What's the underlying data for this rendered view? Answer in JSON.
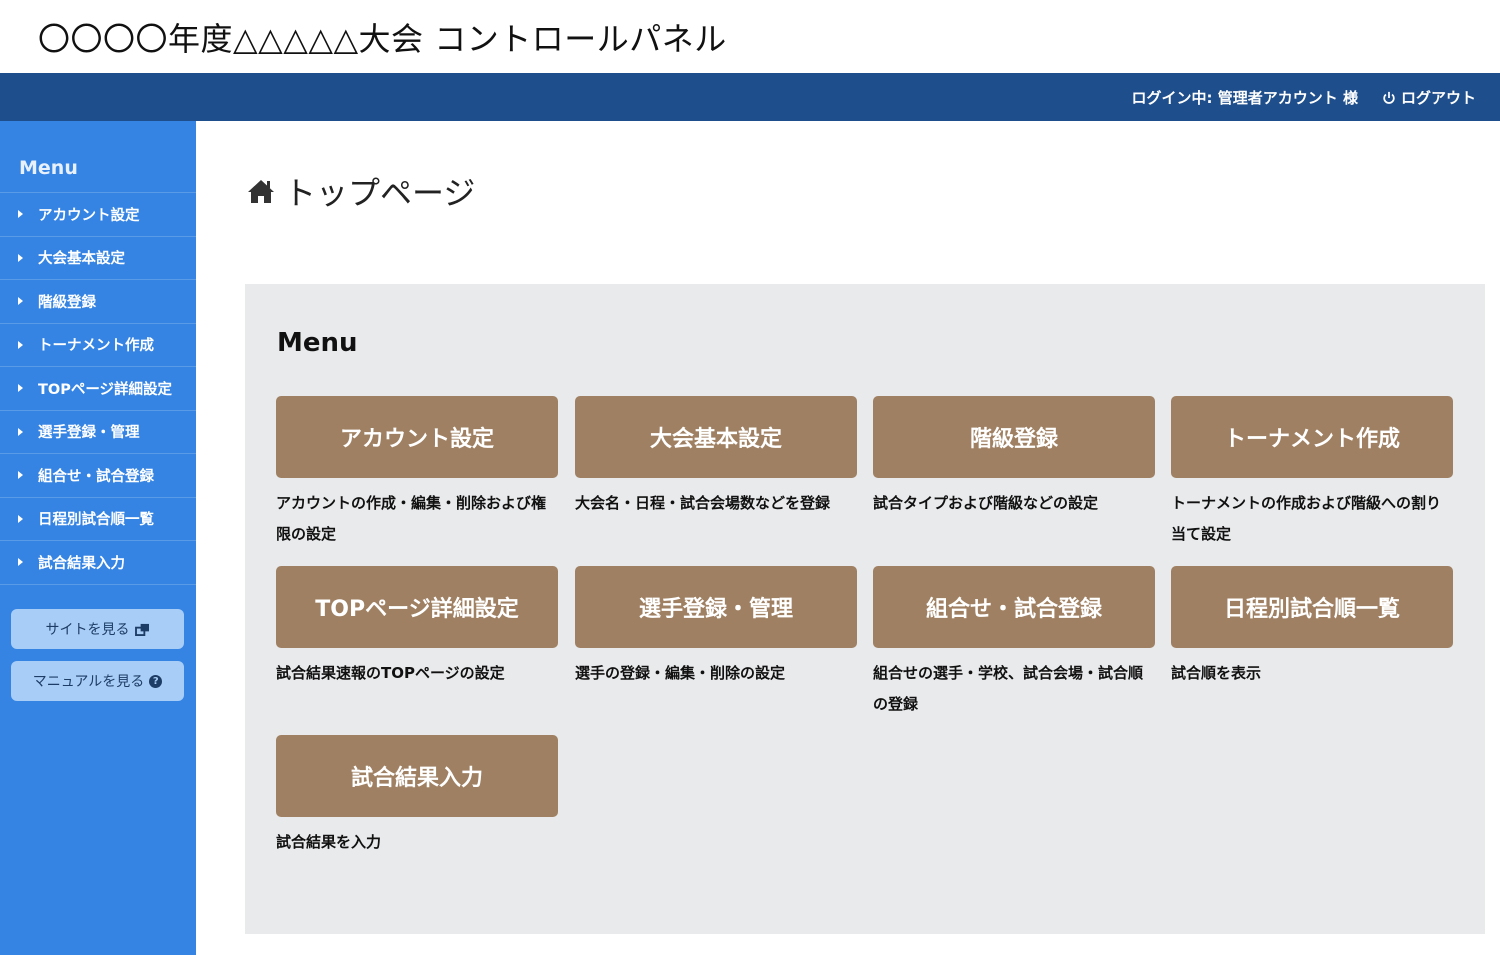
{
  "header": {
    "title": "〇〇〇〇年度△△△△△大会 コントロールパネル"
  },
  "topbar": {
    "login_info": "ログイン中: 管理者アカウント 様",
    "logout_label": "ログアウト"
  },
  "sidebar": {
    "title": "Menu",
    "items": [
      {
        "label": "アカウント設定"
      },
      {
        "label": "大会基本設定"
      },
      {
        "label": "階級登録"
      },
      {
        "label": "トーナメント作成"
      },
      {
        "label": "TOPページ詳細設定"
      },
      {
        "label": "選手登録・管理"
      },
      {
        "label": "組合せ・試合登録"
      },
      {
        "label": "日程別試合順一覧"
      },
      {
        "label": "試合結果入力"
      }
    ],
    "site_button": "サイトを見る",
    "manual_button": "マニュアルを見る"
  },
  "page": {
    "heading": "トップページ"
  },
  "menu": {
    "title": "Menu",
    "cards": [
      {
        "label": "アカウント設定",
        "description": "アカウントの作成・編集・削除および権限の設定"
      },
      {
        "label": "大会基本設定",
        "description": "大会名・日程・試合会場数などを登録"
      },
      {
        "label": "階級登録",
        "description": "試合タイプおよび階級などの設定"
      },
      {
        "label": "トーナメント作成",
        "description": "トーナメントの作成および階級への割り当て設定"
      },
      {
        "label": "TOPページ詳細設定",
        "description": "試合結果速報のTOPページの設定"
      },
      {
        "label": "選手登録・管理",
        "description": "選手の登録・編集・削除の設定"
      },
      {
        "label": "組合せ・試合登録",
        "description": "組合せの選手・学校、試合会場・試合順の登録"
      },
      {
        "label": "日程別試合順一覧",
        "description": "試合順を表示"
      },
      {
        "label": "試合結果入力",
        "description": "試合結果を入力"
      }
    ]
  },
  "colors": {
    "topbar": "#1e4e8b",
    "sidebar": "#3584e4",
    "card_button": "#a08062",
    "panel": "#e9eaec"
  }
}
